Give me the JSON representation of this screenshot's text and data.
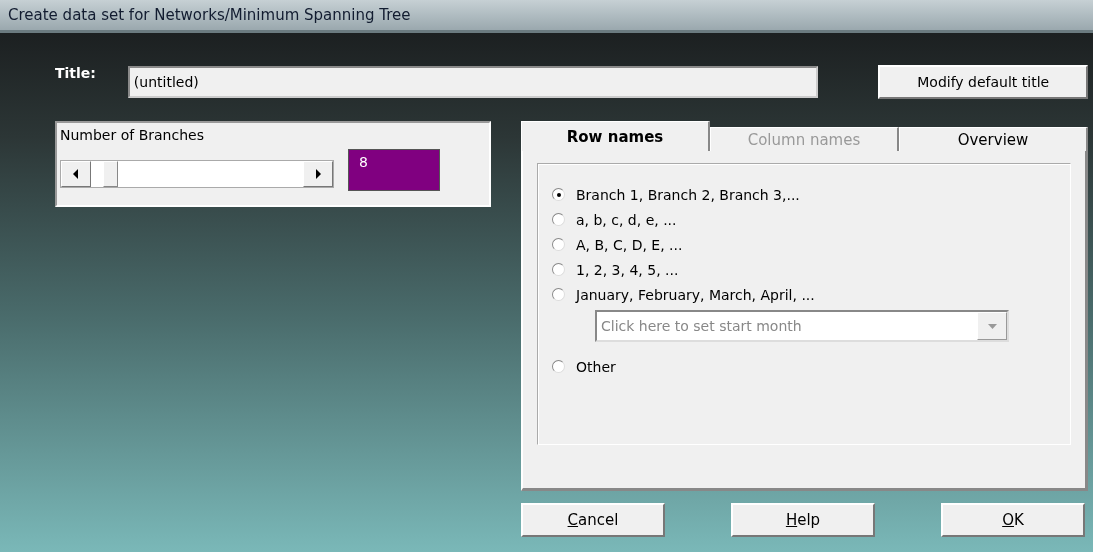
{
  "window": {
    "title": "Create data set for Networks/Minimum Spanning Tree"
  },
  "title_row": {
    "label": "Title:",
    "value": "(untitled)",
    "button": "Modify default title"
  },
  "branches": {
    "label": "Number of Branches",
    "value": "8"
  },
  "tabs": [
    {
      "label": "Row names",
      "selected": true,
      "disabled": false
    },
    {
      "label": "Column names",
      "selected": false,
      "disabled": true
    },
    {
      "label": "Overview",
      "selected": false,
      "disabled": false
    }
  ],
  "row_names": {
    "options": [
      {
        "label": "Branch 1, Branch 2, Branch 3,...",
        "selected": true
      },
      {
        "label": "a, b, c, d, e, ...",
        "selected": false
      },
      {
        "label": "A, B, C, D, E, ...",
        "selected": false
      },
      {
        "label": "1, 2, 3, 4, 5, ...",
        "selected": false
      },
      {
        "label": "January, February, March, April, ...",
        "selected": false,
        "kind": "month"
      },
      {
        "label": "Other",
        "selected": false
      }
    ],
    "month_dropdown": {
      "placeholder": "Click here to set start month"
    }
  },
  "buttons": [
    {
      "label": "Cancel",
      "underline_first": true
    },
    {
      "label": "Help",
      "underline_first": true
    },
    {
      "label": "OK",
      "underline_first": true
    }
  ]
}
